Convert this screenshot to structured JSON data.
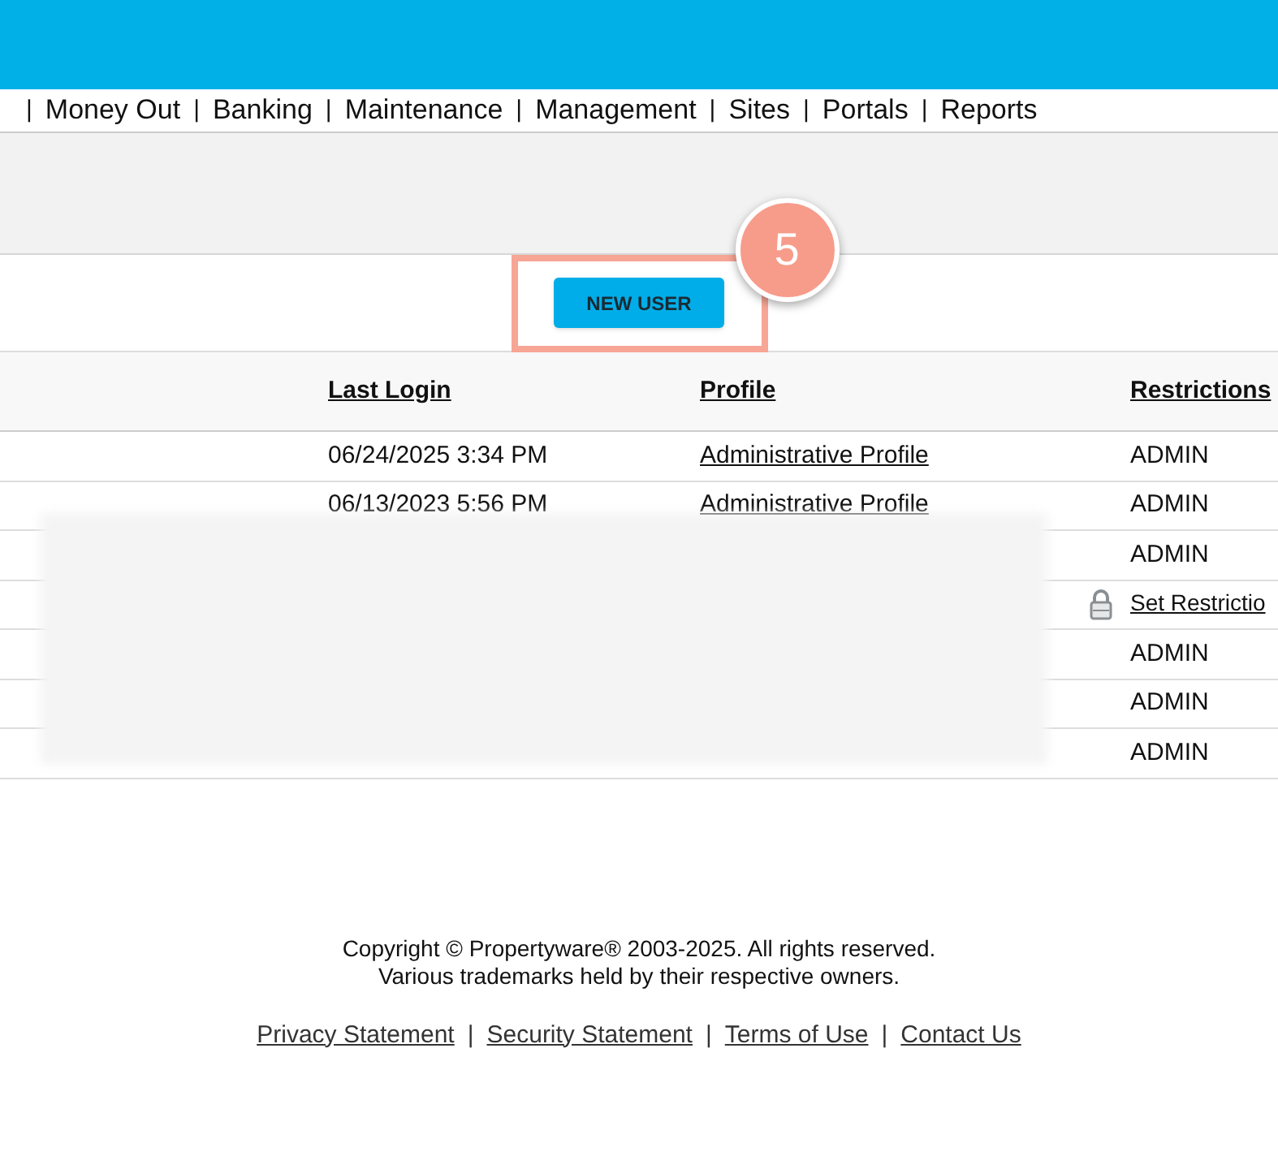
{
  "nav": [
    {
      "divider": "|",
      "label": "Money Out"
    },
    {
      "divider": "|",
      "label": "Banking"
    },
    {
      "divider": "|",
      "label": "Maintenance"
    },
    {
      "divider": "|",
      "label": "Management"
    },
    {
      "divider": "|",
      "label": "Sites"
    },
    {
      "divider": "|",
      "label": "Portals"
    },
    {
      "divider": "|",
      "label": "Reports"
    }
  ],
  "new_user_button": "NEW USER",
  "step_badge": "5",
  "table": {
    "columns": [
      "Last Login",
      "Profile",
      "Restrictions"
    ],
    "rows": [
      {
        "last_login": "06/24/2025 3:34 PM",
        "profile": "Administrative Profile",
        "kind": "text",
        "restriction": "ADMIN"
      },
      {
        "last_login": "06/13/2023 5:56 PM",
        "profile": "Administrative Profile",
        "kind": "text",
        "restriction": "ADMIN"
      },
      {
        "kind": "text",
        "restriction": "ADMIN"
      },
      {
        "kind": "locked",
        "restriction": "Set Restrictio"
      },
      {
        "kind": "text",
        "restriction": "ADMIN"
      },
      {
        "kind": "text",
        "restriction": "ADMIN"
      },
      {
        "kind": "text",
        "restriction": "ADMIN"
      }
    ]
  },
  "footer": {
    "lines": [
      "Copyright © Propertyware® 2003-2025. All rights reserved.",
      "Various trademarks held by their respective owners."
    ],
    "links": [
      {
        "label": "Privacy Statement"
      },
      {
        "divider": "|",
        "label": "Security Statement"
      },
      {
        "divider": "|",
        "label": "Terms of Use"
      },
      {
        "divider": "|",
        "label": "Contact Us"
      }
    ]
  }
}
